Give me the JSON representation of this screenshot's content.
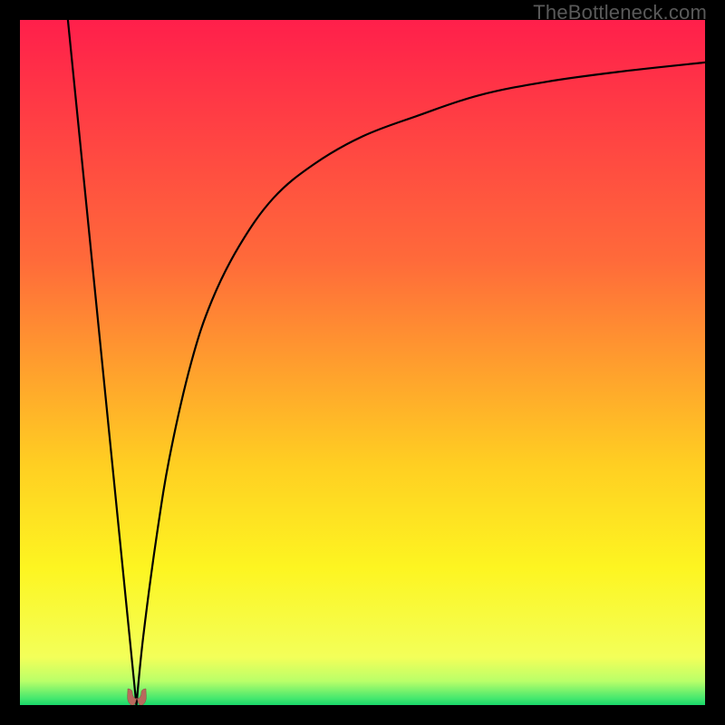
{
  "watermark": "TheBottleneck.com",
  "colors": {
    "gradient_stops": [
      {
        "offset": "0%",
        "color": "#ff1f4b"
      },
      {
        "offset": "35%",
        "color": "#ff6a3a"
      },
      {
        "offset": "65%",
        "color": "#ffcf22"
      },
      {
        "offset": "80%",
        "color": "#fdf521"
      },
      {
        "offset": "93%",
        "color": "#f3ff59"
      },
      {
        "offset": "96.5%",
        "color": "#baff69"
      },
      {
        "offset": "99%",
        "color": "#46e86e"
      },
      {
        "offset": "100%",
        "color": "#19d66a"
      }
    ],
    "curve_stroke": "#000000",
    "marker_fill": "#b9695d"
  },
  "chart_data": {
    "type": "line",
    "title": "",
    "xlabel": "",
    "ylabel": "",
    "xlim": [
      0,
      100
    ],
    "ylim": [
      0,
      100
    ],
    "optimum_x": 17,
    "series": [
      {
        "name": "left-branch",
        "x": [
          7,
          8,
          9,
          10,
          11,
          12,
          13,
          14,
          15,
          16,
          17
        ],
        "y": [
          100,
          90,
          80,
          70,
          60,
          50,
          40,
          30,
          20,
          10,
          0
        ]
      },
      {
        "name": "right-branch",
        "x": [
          17,
          18,
          20,
          22,
          25,
          28,
          32,
          37,
          43,
          50,
          58,
          67,
          77,
          88,
          100
        ],
        "y": [
          0,
          10,
          25,
          37,
          50,
          59,
          67,
          74,
          79,
          83,
          86,
          89,
          91,
          92.5,
          93.8
        ]
      }
    ],
    "annotations": []
  }
}
